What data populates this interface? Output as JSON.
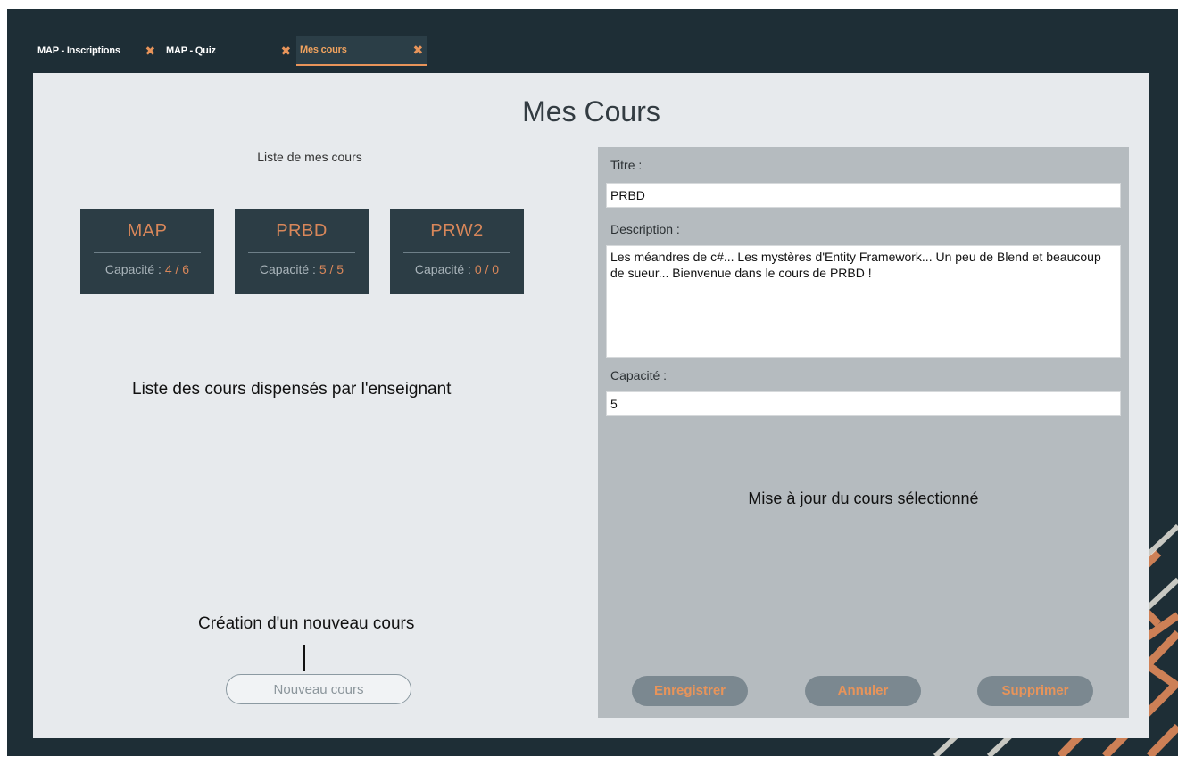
{
  "tabs": [
    {
      "label": "MAP - Inscriptions",
      "close": "✖",
      "active": false
    },
    {
      "label": "MAP - Quiz",
      "close": "✖",
      "active": false
    },
    {
      "label": "Mes cours",
      "close": "✖",
      "active": true
    }
  ],
  "page": {
    "title": "Mes Cours",
    "list_heading": "Liste de mes cours"
  },
  "courses": [
    {
      "title": "MAP",
      "capacity_label": "Capacité : ",
      "capacity": "4 / 6"
    },
    {
      "title": "PRBD",
      "capacity_label": "Capacité : ",
      "capacity": "5 / 5"
    },
    {
      "title": "PRW2",
      "capacity_label": "Capacité : ",
      "capacity": "0 / 0"
    }
  ],
  "annotations": {
    "course_list": "Liste des cours dispensés par l'enseignant",
    "new_course": "Création d'un nouveau cours",
    "update": "Mise à jour du cours sélectionné"
  },
  "new_course_button": "Nouveau cours",
  "form": {
    "title_label": "Titre :",
    "title_value": "PRBD",
    "description_label": "Description :",
    "description_value": "Les méandres de c#... Les mystères d'Entity Framework... Un peu de Blend et beaucoup de sueur... Bienvenue dans le cours de PRBD !",
    "capacity_label": "Capacité :",
    "capacity_value": "5"
  },
  "actions": {
    "save": "Enregistrer",
    "cancel": "Annuler",
    "delete": "Supprimer"
  },
  "colors": {
    "background": "#1e2e36",
    "accent": "#e8945a",
    "card": "#2c3d45",
    "panel": "#e7eaed",
    "edit_panel": "#b5bbbf"
  }
}
